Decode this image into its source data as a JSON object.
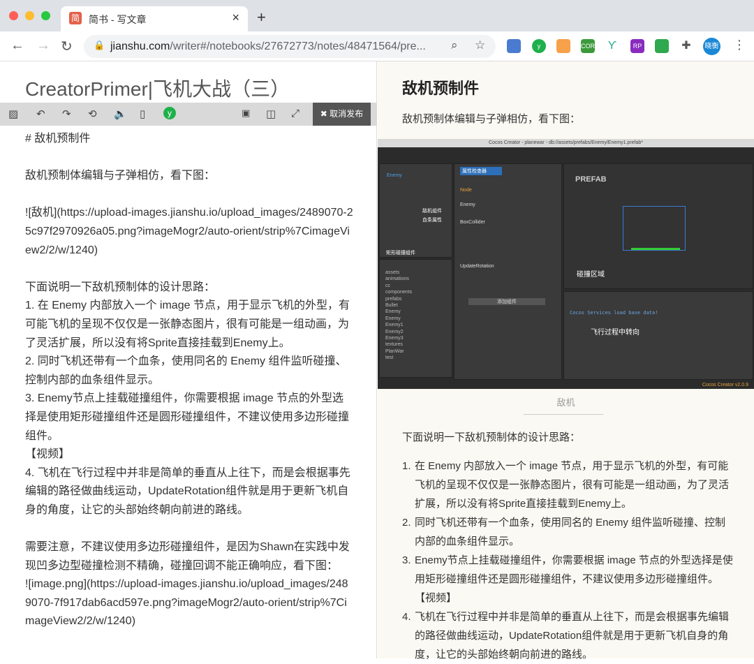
{
  "browser": {
    "tab_title": "简书 - 写文章",
    "favicon": "简",
    "url_host": "jianshu.com",
    "url_path": "/writer#/notebooks/27672773/notes/48471564/pre...",
    "profile": "晓衡",
    "extensions": [
      "CORS",
      "RP"
    ]
  },
  "editor": {
    "title": "CreatorPrimer|飞机大战（三）",
    "unpublish_label": "✖ 取消发布",
    "lines": [
      "# 敌机预制件",
      "",
      "敌机预制体编辑与子弹相仿，看下图：",
      "",
      "![敌机](https://upload-images.jianshu.io/upload_images/2489070-25c97f2970926a05.png?imageMogr2/auto-orient/strip%7CimageView2/2/w/1240)",
      "",
      "下面说明一下敌机预制体的设计思路：",
      "1. 在 Enemy 内部放入一个 image 节点，用于显示飞机的外型，有可能飞机的呈现不仅仅是一张静态图片，很有可能是一组动画，为了灵活扩展，所以没有将Sprite直接挂载到Enemy上。",
      "2. 同时飞机还带有一个血条，使用同名的 Enemy 组件监听碰撞、控制内部的血条组件显示。",
      "3. Enemy节点上挂载碰撞组件，你需要根据 image 节点的外型选择是使用矩形碰撞组件还是圆形碰撞组件，不建议使用多边形碰撞组件。",
      " 【视频】",
      "4. 飞机在飞行过程中并非是简单的垂直从上往下，而是会根据事先编辑的路径做曲线运动，UpdateRotation组件就是用于更新飞机自身的角度，让它的头部始终朝向前进的路线。",
      "",
      "需要注意，不建议使用多边形碰撞组件，是因为Shawn在实践中发现凹多边型碰撞检测不精确，碰撞回调不能正确响应，看下图：",
      "![image.png](https://upload-images.jianshu.io/upload_images/2489070-7f917dab6acd597e.png?imageMogr2/auto-orient/strip%7CimageView2/2/w/1240)"
    ]
  },
  "preview": {
    "heading": "敌机预制件",
    "intro": "敌机预制体编辑与子弹相仿，看下图：",
    "caption": "敌机",
    "design_intro": "下面说明一下敌机预制体的设计思路：",
    "image": {
      "window_title": "Cocos Creator - planewar - db://assets/prefabs/Enemy/Enemy1.prefab*",
      "inspector": "属性检查器",
      "prefab_label": "PREFAB",
      "console_text": "Cocos Services load base data!",
      "version": "Cocos Creator v2.0.9",
      "annotations": [
        "敌机组件",
        "血条属性",
        "矩形碰撞组件",
        "碰撞区域",
        "飞行过程中转向"
      ],
      "components": [
        "Enemy",
        "Node",
        "Enemy",
        "BoxCollider",
        "UpdateRotation"
      ],
      "add_component": "添加组件",
      "tree": [
        "assets",
        "animations",
        "cc",
        "components",
        "prefabs",
        "Bullet",
        "Enemy",
        "Enemy",
        "Enemy1",
        "Enemy2",
        "Enemy3",
        "textures",
        "PlanWar",
        "test"
      ]
    },
    "items": [
      {
        "n": "1.",
        "t": "在 Enemy 内部放入一个 image 节点，用于显示飞机的外型，有可能飞机的呈现不仅仅是一张静态图片，很有可能是一组动画，为了灵活扩展，所以没有将Sprite直接挂载到Enemy上。"
      },
      {
        "n": "2.",
        "t": "同时飞机还带有一个血条，使用同名的 Enemy 组件监听碰撞、控制内部的血条组件显示。"
      },
      {
        "n": "3.",
        "t": "Enemy节点上挂载碰撞组件，你需要根据 image 节点的外型选择是使用矩形碰撞组件还是圆形碰撞组件，不建议使用多边形碰撞组件。"
      },
      {
        "n": "",
        "t": "【视频】"
      },
      {
        "n": "4.",
        "t": "飞机在飞行过程中并非是简单的垂直从上往下，而是会根据事先编辑的路径做曲线运动，UpdateRotation组件就是用于更新飞机自身的角度，让它的头部始终朝向前进的路线。"
      }
    ]
  }
}
